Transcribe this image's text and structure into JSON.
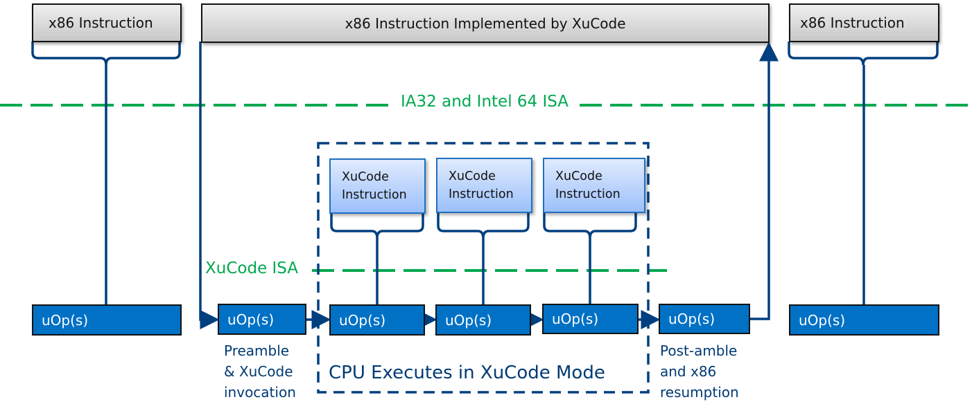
{
  "top_instructions": {
    "left": "x86 Instruction",
    "middle": "x86 Instruction Implemented by XuCode",
    "right": "x86 Instruction"
  },
  "isa_labels": {
    "upper": "IA32 and Intel 64 ISA",
    "lower": "XuCode ISA"
  },
  "xucode_instructions": [
    {
      "line1": "XuCode",
      "line2": "Instruction"
    },
    {
      "line1": "XuCode",
      "line2": "Instruction"
    },
    {
      "line1": "XuCode",
      "line2": "Instruction"
    }
  ],
  "uops": [
    "uOp(s)",
    "uOp(s)",
    "uOp(s)",
    "uOp(s)",
    "uOp(s)",
    "uOp(s)",
    "uOp(s)"
  ],
  "annotations": {
    "preamble": [
      "Preamble",
      "& XuCode",
      "invocation"
    ],
    "postamble": [
      "Post-amble",
      "and x86",
      "resumption"
    ],
    "xucode_mode": "CPU Executes in XuCode Mode"
  },
  "colors": {
    "line_blue": "#003f7f",
    "isa_green": "#00a84f",
    "uop_fill": "#0071c5",
    "xucode_border": "#1f6fc0"
  }
}
